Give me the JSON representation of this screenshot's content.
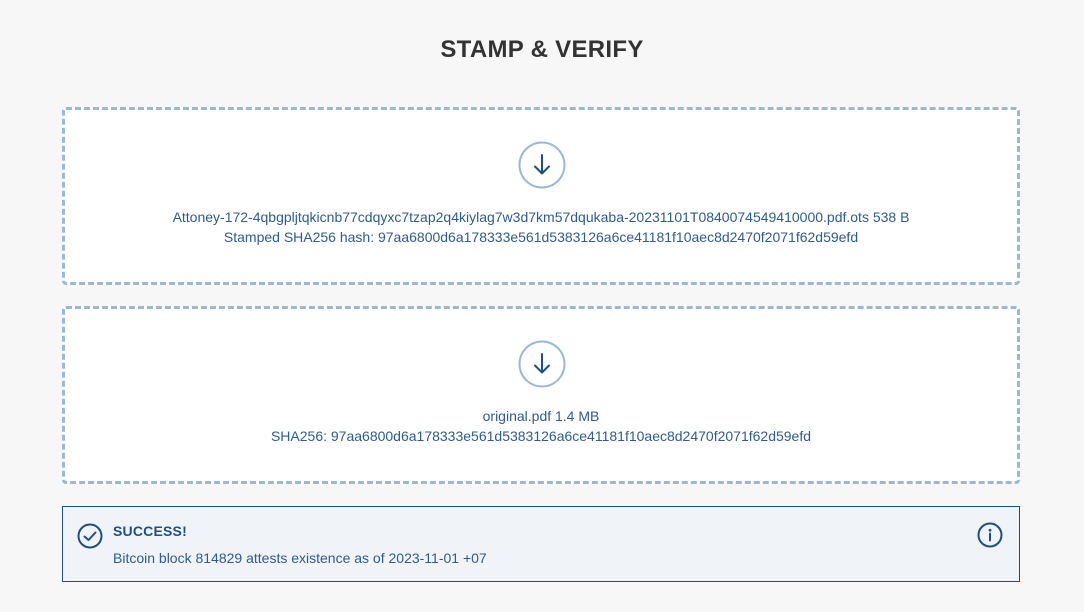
{
  "page": {
    "title": "STAMP & VERIFY"
  },
  "stamp_file": {
    "icon": "download-arrow-icon",
    "name_line": "Attoney-172-4qbgpljtqkicnb77cdqyxc7tzap2q4kiylag7w3d7km57dqukaba-20231101T0840074549410000.pdf.ots 538 B",
    "hash_line": "Stamped SHA256 hash: 97aa6800d6a178333e561d5383126a6ce41181f10aec8d2470f2071f62d59efd"
  },
  "original_file": {
    "icon": "download-arrow-icon",
    "name_line": "original.pdf 1.4 MB",
    "hash_line": "SHA256: 97aa6800d6a178333e561d5383126a6ce41181f10aec8d2470f2071f62d59efd"
  },
  "result": {
    "status_icon": "check-circle-icon",
    "title": "SUCCESS!",
    "message": "Bitcoin block 814829 attests existence as of 2023-11-01 +07",
    "info_icon": "info-icon"
  },
  "colors": {
    "background": "#f7f7f7",
    "dropzone_border": "#9cb8d4",
    "accent": "#1f4f82",
    "text_link": "#2f5b8e",
    "alert_background": "#f0f3f7"
  }
}
